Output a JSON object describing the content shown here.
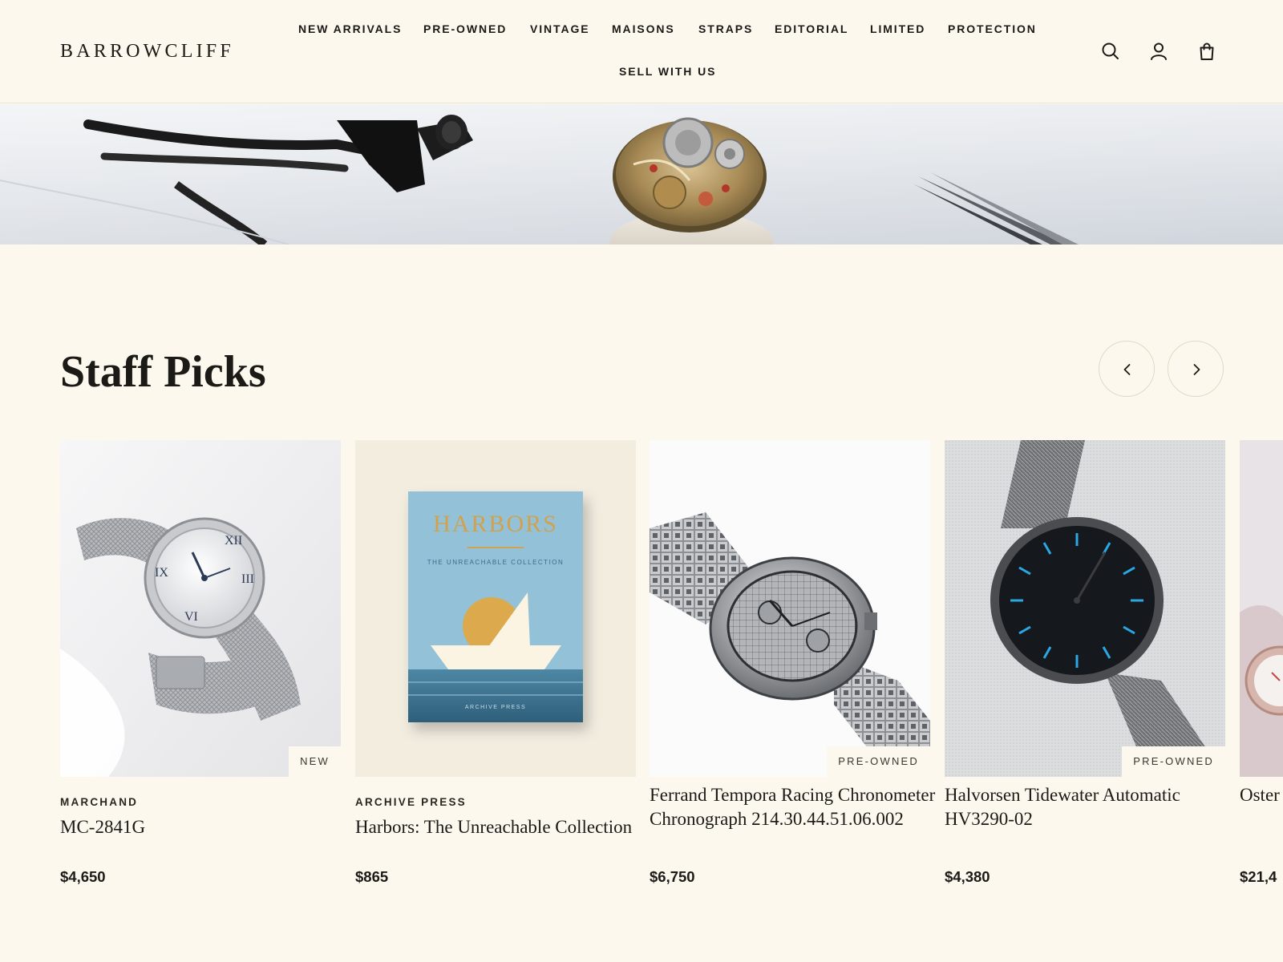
{
  "header": {
    "logo": "BARROWCLIFF",
    "nav": [
      {
        "label": "NEW ARRIVALS"
      },
      {
        "label": "PRE-OWNED"
      },
      {
        "label": "VINTAGE"
      },
      {
        "label": "MAISONS"
      },
      {
        "label": "STRAPS"
      },
      {
        "label": "EDITORIAL"
      },
      {
        "label": "LIMITED"
      },
      {
        "label": "PROTECTION"
      },
      {
        "label": "SELL WITH US"
      }
    ],
    "icons": [
      "search-icon",
      "account-icon",
      "bag-icon"
    ]
  },
  "hero": {
    "description_icons": [
      "loupe-glasses",
      "watch-movement",
      "tweezers"
    ]
  },
  "section": {
    "title": "Staff Picks",
    "prev_icon": "chevron-left-icon",
    "next_icon": "chevron-right-icon"
  },
  "products": [
    {
      "brand": "MARCHAND",
      "name": "MC-2841G",
      "price": "$4,650",
      "badge": "NEW"
    },
    {
      "brand": "ARCHIVE PRESS",
      "name": "Harbors: The Unreachable Collection",
      "price": "$865",
      "badge": "",
      "cover": {
        "title": "HARBORS",
        "subtitle": "THE UNREACHABLE COLLECTION",
        "publisher": "ARCHIVE PRESS"
      }
    },
    {
      "brand": "",
      "name": "Ferrand Tempora Racing Chronometer Chronograph 214.30.44.51.06.002",
      "price": "$6,750",
      "badge": "PRE-OWNED"
    },
    {
      "brand": "",
      "name": "Halvorsen Tidewater Automatic HV3290-02",
      "price": "$4,380",
      "badge": "PRE-OWNED"
    },
    {
      "brand": "",
      "name": "Oster",
      "price": "$21,4",
      "badge": ""
    }
  ],
  "colors": {
    "background": "#fcf8ee",
    "text": "#1c1a17",
    "accent_blue": "#2aa8e6"
  }
}
